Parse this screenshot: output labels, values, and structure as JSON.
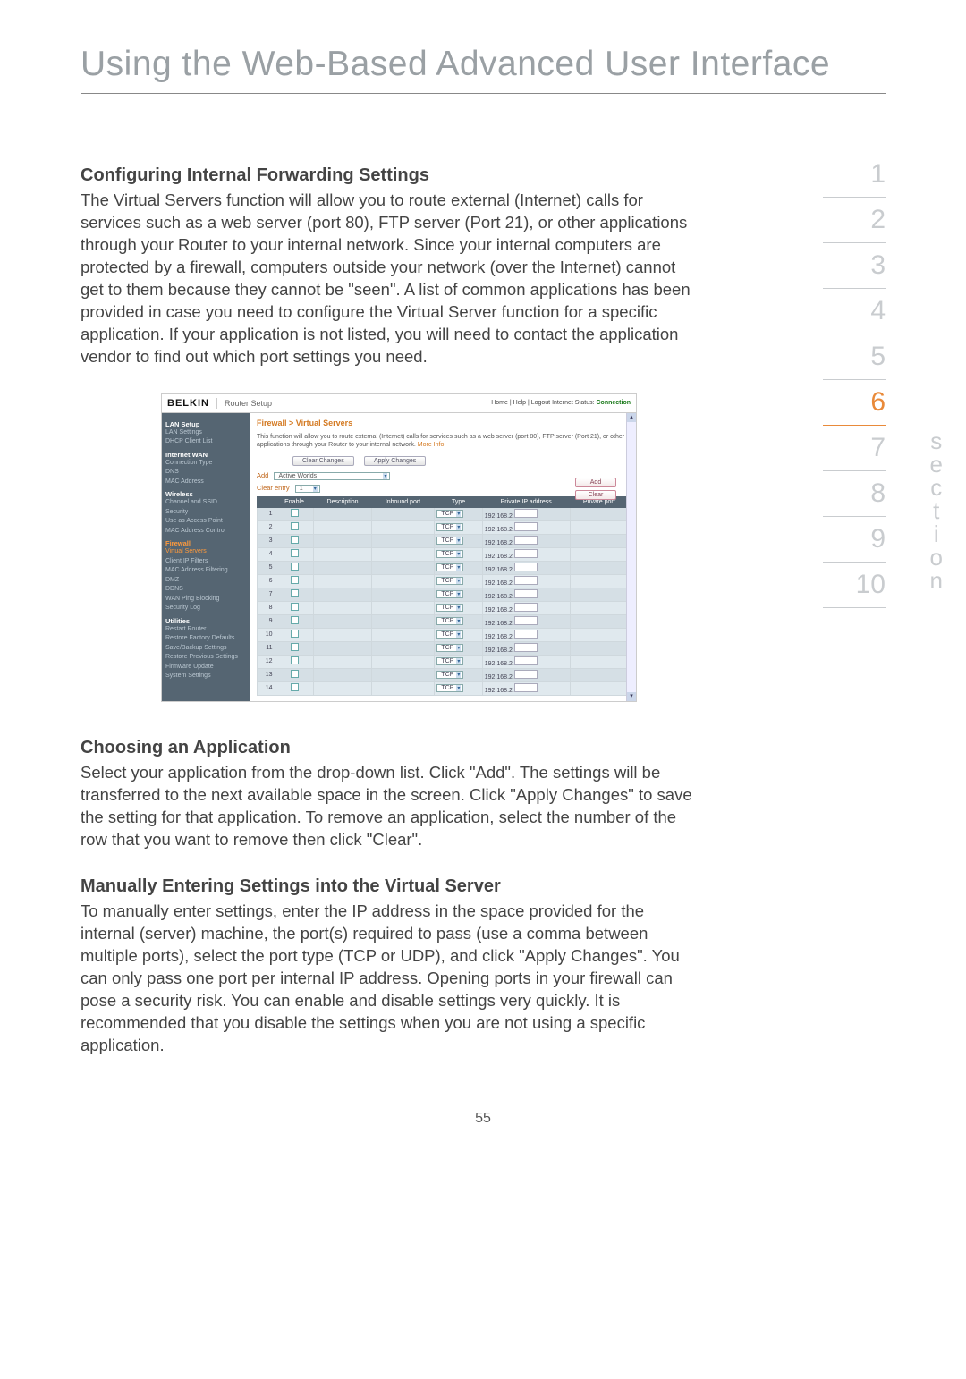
{
  "main_title": "Using the Web-Based Advanced User Interface",
  "page_number": "55",
  "section_label": "section",
  "nav_numbers": [
    "1",
    "2",
    "3",
    "4",
    "5",
    "6",
    "7",
    "8",
    "9",
    "10"
  ],
  "nav_active_index": 5,
  "sections": {
    "s1": {
      "heading": "Configuring Internal Forwarding Settings",
      "body": "The Virtual Servers function will allow you to route external (Internet) calls for services such as a web server (port 80), FTP server (Port 21), or other applications through your Router to your internal network. Since your internal computers are protected by a firewall, computers outside your network (over the Internet) cannot get to them because they cannot be \"seen\". A list of common applications has been provided in case you need to configure the Virtual Server function for a specific application. If your application is not listed, you will need to contact the application vendor to find out which port settings you need."
    },
    "s2": {
      "heading": "Choosing an Application",
      "body": "Select your application from the drop-down list. Click \"Add\". The settings will be transferred to the next available space in the screen. Click \"Apply Changes\" to save the setting for that application. To remove an application, select the number of the row that you want to remove then click \"Clear\"."
    },
    "s3": {
      "heading": "Manually Entering Settings into the Virtual Server",
      "body": "To manually enter settings, enter the IP address in the space provided for the internal (server) machine, the port(s) required to pass (use a comma between multiple ports), select the port type (TCP or UDP), and click \"Apply Changes\". You can only pass one port per internal IP address. Opening ports in your firewall can pose a security risk. You can enable and disable settings very quickly. It is recommended that you disable the settings when you are not using a specific application."
    }
  },
  "router": {
    "brand": "BELKIN",
    "title": "Router Setup",
    "links": "Home | Help | Logout   Internet Status:",
    "status": "Connection",
    "nav": {
      "g1": "LAN Setup",
      "g1_items": [
        "LAN Settings",
        "DHCP Client List"
      ],
      "g2": "Internet WAN",
      "g2_items": [
        "Connection Type",
        "DNS",
        "MAC Address"
      ],
      "g3": "Wireless",
      "g3_items": [
        "Channel and SSID",
        "Security",
        "Use as Access Point",
        "MAC Address Control"
      ],
      "g4": "Firewall",
      "g4_items": [
        "Virtual Servers",
        "Client IP Filters",
        "MAC Address Filtering",
        "DMZ",
        "DDNS",
        "WAN Ping Blocking",
        "Security Log"
      ],
      "g5": "Utilities",
      "g5_items": [
        "Restart Router",
        "Restore Factory Defaults",
        "Save/Backup Settings",
        "Restore Previous Settings",
        "Firmware Update",
        "System Settings"
      ]
    },
    "crumb": "Firewall > Virtual Servers",
    "desc": "This function will allow you to route external (Internet) calls for services such as a web server (port 80), FTP server (Port 21), or other applications through your Router to your internal network. ",
    "more": "More Info",
    "btn_clear": "Clear Changes",
    "btn_apply": "Apply Changes",
    "btn_add": "Add",
    "btn_clr": "Clear",
    "add_label": "Add",
    "add_select": "Active Worlds",
    "clear_label": "Clear entry",
    "clear_select": "1",
    "headers": [
      "",
      "Enable",
      "Description",
      "Inbound port",
      "Type",
      "Private IP address",
      "Private port"
    ],
    "type_value": "TCP",
    "ip_prefix": "192.168.2.",
    "rows": 14
  }
}
